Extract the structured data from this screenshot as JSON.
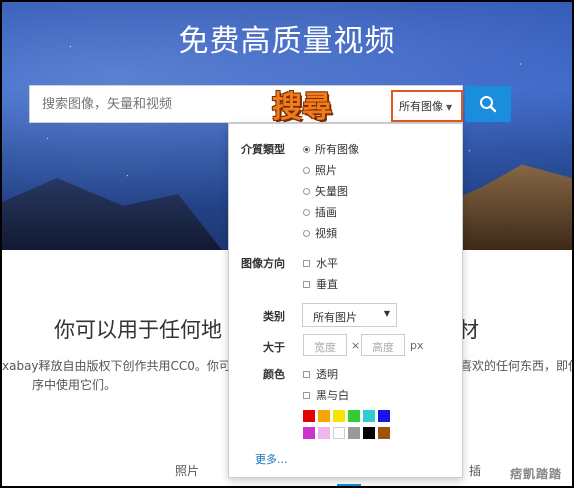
{
  "hero": {
    "title": "免费高质量视频"
  },
  "search": {
    "placeholder": "搜索图像，矢量和视频",
    "type_value": "所有图像"
  },
  "annotation": {
    "text": "搜尋"
  },
  "dropdown": {
    "media_type_label": "介質類型",
    "media_types": [
      {
        "label": "所有图像",
        "selected": true
      },
      {
        "label": "照片",
        "selected": false
      },
      {
        "label": "矢量图",
        "selected": false
      },
      {
        "label": "插画",
        "selected": false
      },
      {
        "label": "视頻",
        "selected": false
      }
    ],
    "orientation_label": "图像方向",
    "orientations": [
      "水平",
      "垂直"
    ],
    "category_label": "类别",
    "category_value": "所有图片",
    "size_label": "大于",
    "width_placeholder": "宽度",
    "times": "×",
    "height_placeholder": "高度",
    "unit": "px",
    "color_label": "颜色",
    "color_options": [
      "透明",
      "黑与白"
    ],
    "swatches": [
      "#e30000",
      "#f7a500",
      "#f5e600",
      "#33cc33",
      "#33cccc",
      "#1515e6",
      "#cc33cc",
      "#f0b6f0",
      "#ffffff",
      "#999999",
      "#000000",
      "#a0520a"
    ],
    "more": "更多..."
  },
  "content": {
    "headline_left": "你可以用于任何地",
    "headline_right": "材",
    "desc_line1_left": "xabay释放自由版权下创作共用CC0。你可",
    "desc_line1_right": "喜欢的任何东西，即使",
    "desc_line2": "序中使用它们。",
    "tab_photos": "照片",
    "tab_right": "插"
  },
  "watermark": "痞凱踏踏"
}
